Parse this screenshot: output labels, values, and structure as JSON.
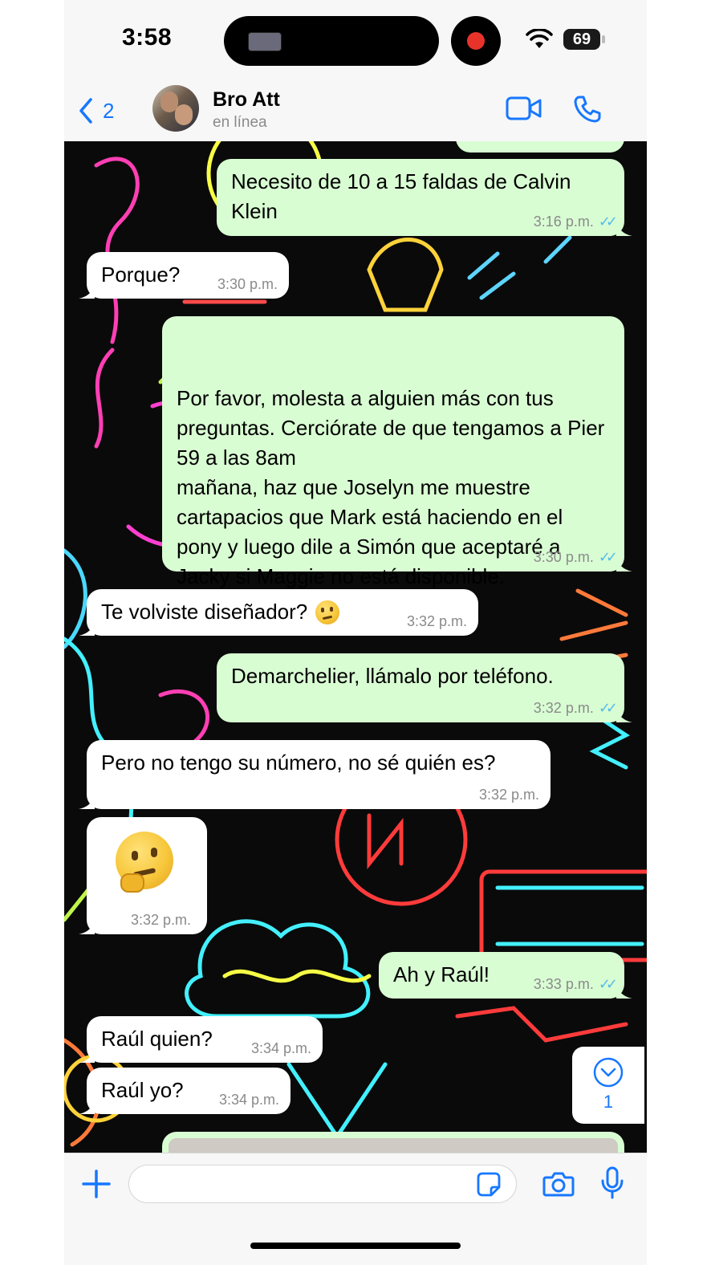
{
  "status_bar": {
    "time": "3:58",
    "battery": "69"
  },
  "header": {
    "back_count": "2",
    "contact_name": "Bro Att",
    "contact_status": "en línea",
    "icons": [
      "chevron-left-icon",
      "video-call-icon",
      "phone-icon"
    ]
  },
  "messages": [
    {
      "dir": "out",
      "text": "Necesito de 10 a 15 faldas de Calvin Klein",
      "time": "3:16 p.m.",
      "status": "read"
    },
    {
      "dir": "in",
      "text": "Porque?",
      "time": "3:30 p.m."
    },
    {
      "dir": "out",
      "text": "Por favor, molesta a alguien más con tus preguntas. Cerciórate de que tengamos a Pier 59 a las 8am\nmañana, haz que Joselyn me muestre cartapacios que Mark está haciendo en el pony y luego dile a Simón que aceptaré a Jacky si Maggie no está disponible.\n¿Confirmó Demarchelier?",
      "time": "3:30 p.m.",
      "status": "read"
    },
    {
      "dir": "in",
      "text": "Te volviste diseñador?",
      "emoji": "thinking-face",
      "time": "3:32 p.m."
    },
    {
      "dir": "out",
      "text": "Demarchelier, llámalo por teléfono.",
      "time": "3:32 p.m.",
      "status": "read"
    },
    {
      "dir": "in",
      "text": "Pero no tengo su número, no sé quién es?",
      "time": "3:32 p.m."
    },
    {
      "dir": "in",
      "emoji": "thinking-face",
      "time": "3:32 p.m."
    },
    {
      "dir": "out",
      "text": "Ah y Raúl!",
      "time": "3:33 p.m.",
      "status": "read"
    },
    {
      "dir": "in",
      "text": "Raúl quien?",
      "time": "3:34 p.m."
    },
    {
      "dir": "in",
      "text": "Raúl yo?",
      "time": "3:34 p.m."
    }
  ],
  "scroll_down": {
    "unread_count": "1"
  },
  "input_bar": {
    "icons": [
      "plus-icon",
      "sticker-icon",
      "camera-icon",
      "microphone-icon"
    ]
  },
  "colors": {
    "outgoing_bubble": "#d9fdd3",
    "incoming_bubble": "#ffffff",
    "accent_blue": "#1677ff",
    "read_ticks": "#53bdeb",
    "wallpaper": "#0a0a0a"
  }
}
